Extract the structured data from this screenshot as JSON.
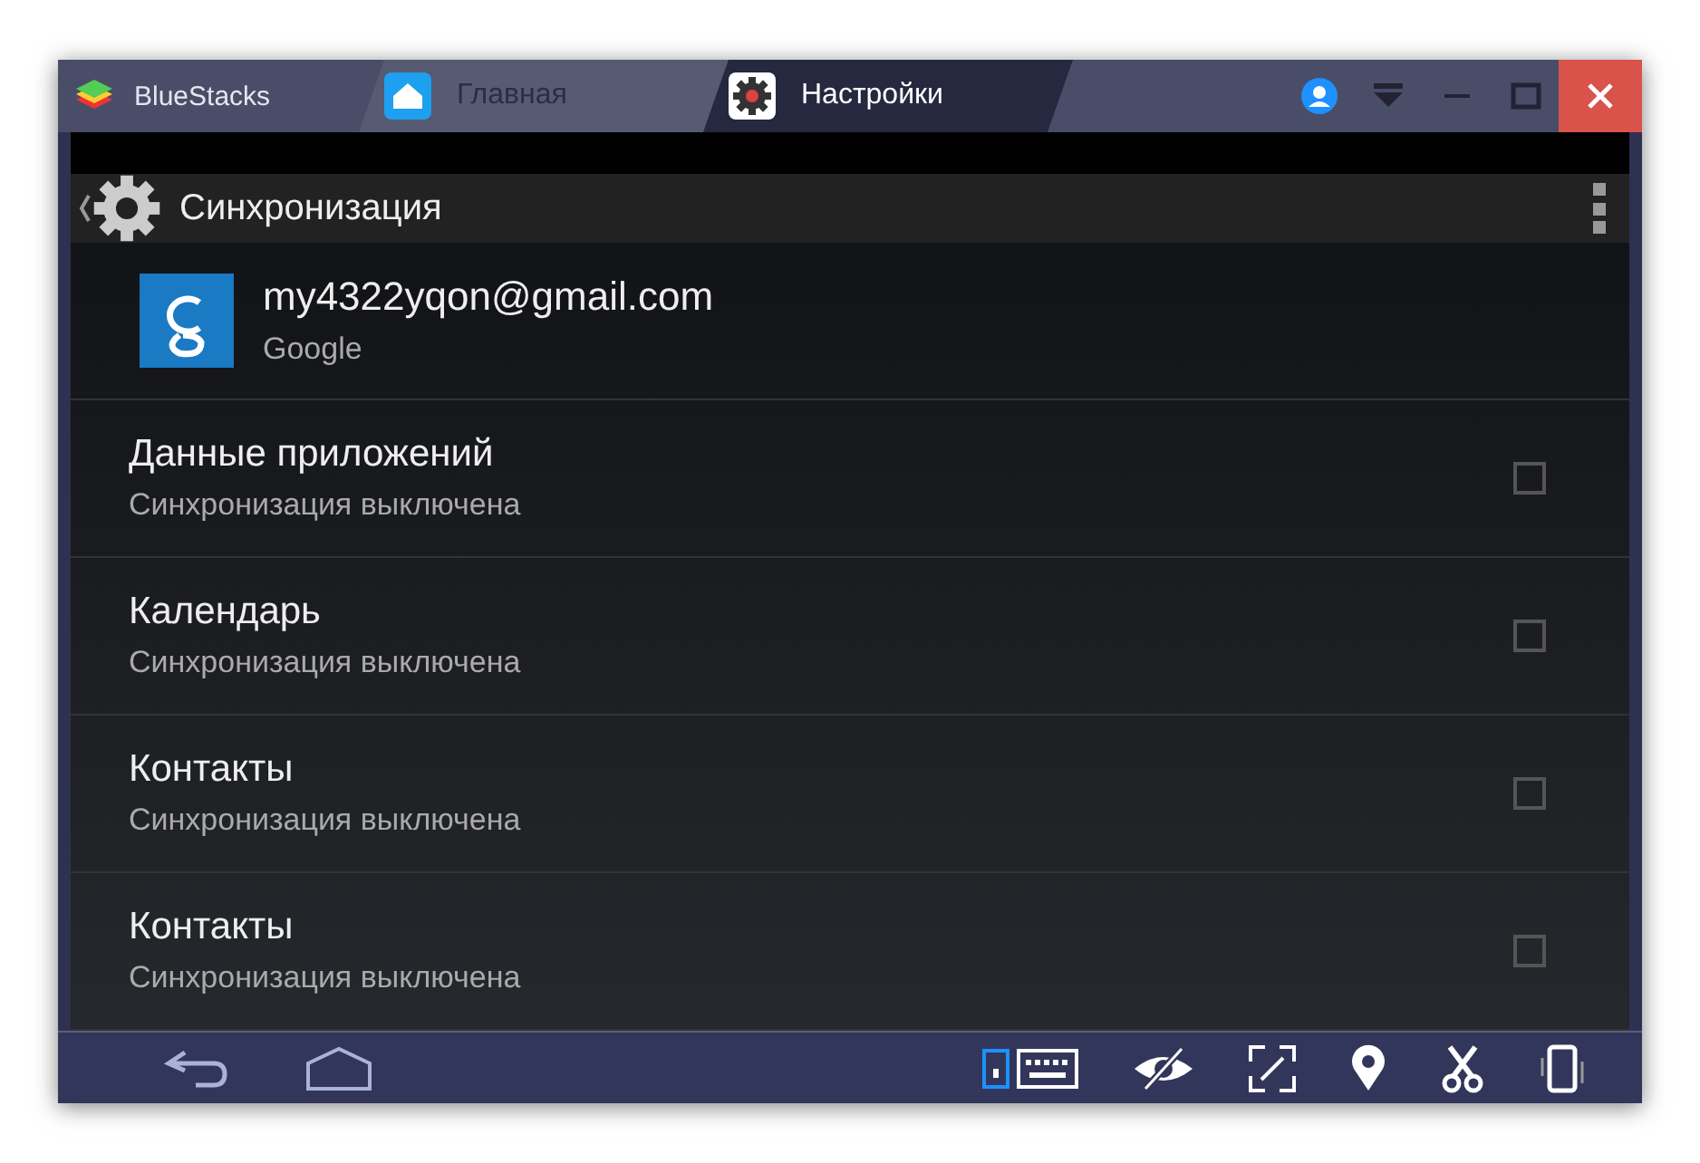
{
  "window": {
    "app_name": "BlueStacks"
  },
  "tabs": [
    {
      "label": "Главная",
      "kind": "home",
      "selected": false
    },
    {
      "label": "Настройки",
      "kind": "settings",
      "selected": true
    }
  ],
  "action_bar": {
    "title": "Синхронизация"
  },
  "account": {
    "email": "my4322yqon@gmail.com",
    "provider": "Google"
  },
  "sync_items": [
    {
      "title": "Данные приложений",
      "subtitle": "Синхронизация выключена",
      "checked": false
    },
    {
      "title": "Календарь",
      "subtitle": "Синхронизация выключена",
      "checked": false
    },
    {
      "title": "Контакты",
      "subtitle": "Синхронизация выключена",
      "checked": false
    },
    {
      "title": "Контакты",
      "subtitle": "Синхронизация выключена",
      "checked": false
    }
  ]
}
